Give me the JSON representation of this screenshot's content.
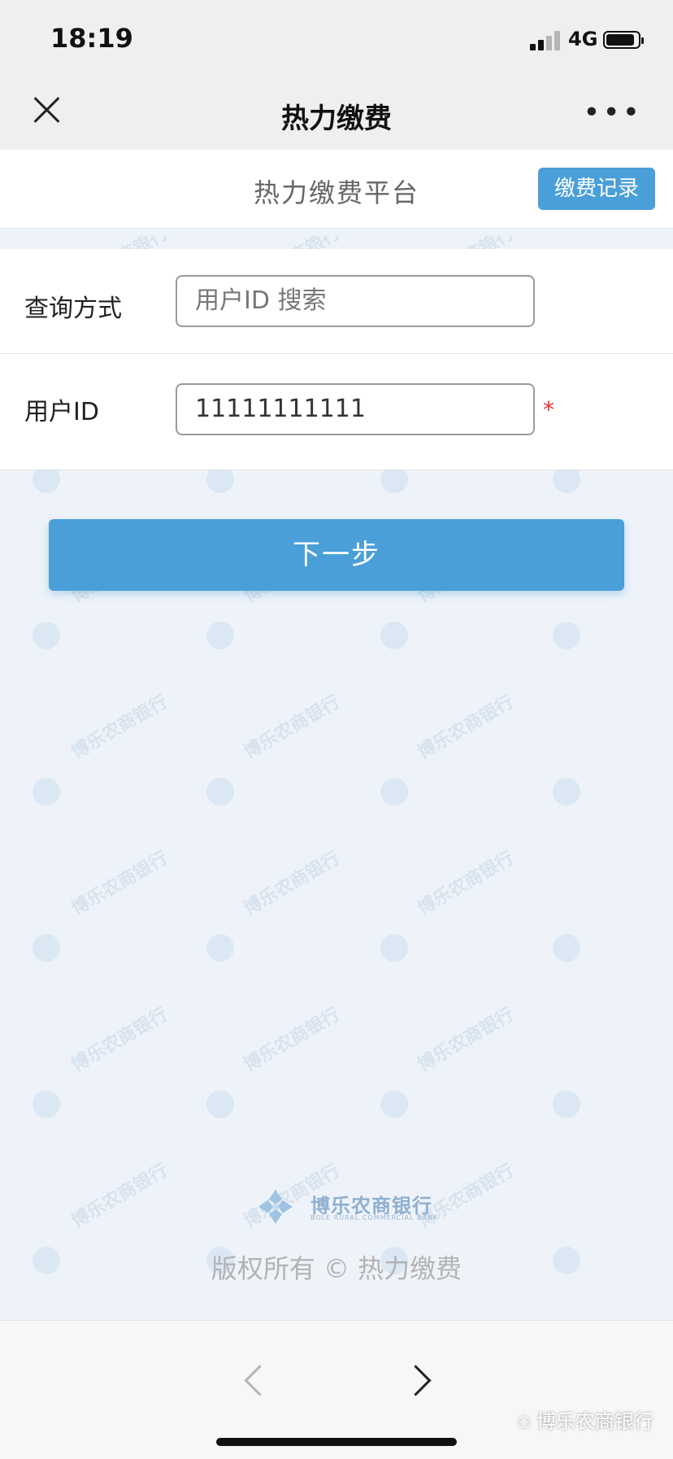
{
  "status_bar": {
    "time": "18:19",
    "network": "4G"
  },
  "nav": {
    "title": "热力缴费"
  },
  "header": {
    "title": "热力缴费平台",
    "record_button": "缴费记录"
  },
  "form": {
    "query_method_label": "查询方式",
    "query_method_value": "用户ID 搜索",
    "user_id_label": "用户ID",
    "user_id_value": "11111111111",
    "required_mark": "*"
  },
  "next_button": "下一步",
  "footer": {
    "logo_cn": "博乐农商银行",
    "logo_en": "BOLE RURAL COMMERCIAL BANK",
    "copyright": "版权所有 © 热力缴费"
  },
  "watermark": {
    "text": "博乐农商银行",
    "source_label": "博乐农商银行"
  },
  "colors": {
    "accent": "#4a9fd8",
    "required": "#e23030",
    "background": "#eef3f9"
  },
  "icons": [
    "close-icon",
    "more-icon",
    "signal-icon",
    "battery-icon",
    "back-arrow-icon",
    "forward-arrow-icon",
    "bank-logo-icon",
    "wechat-icon"
  ]
}
